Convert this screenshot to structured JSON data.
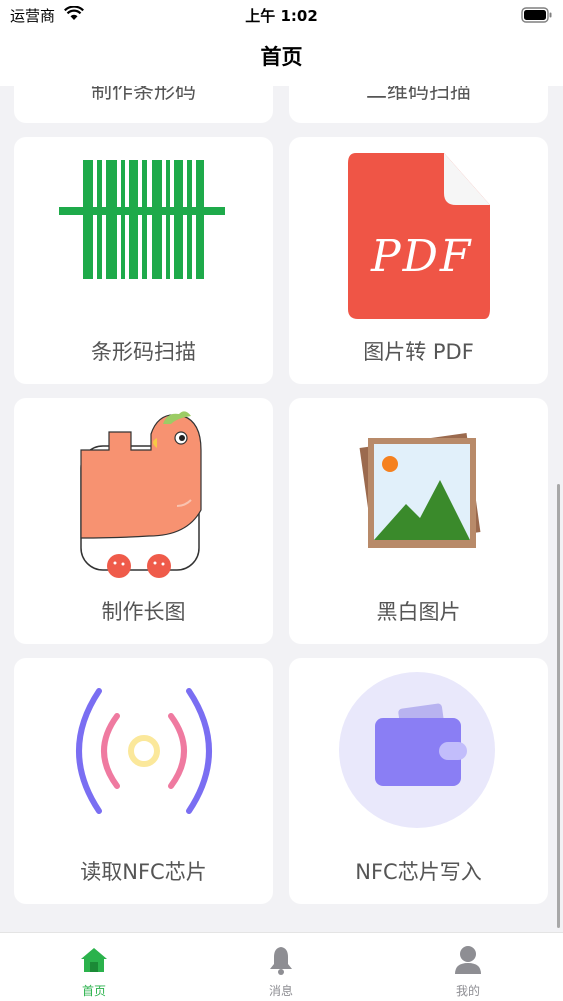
{
  "status_bar": {
    "carrier": "运营商",
    "time": "上午 1:02"
  },
  "nav": {
    "title": "首页"
  },
  "grid": {
    "partial_top": [
      {
        "label": "制作条形码"
      },
      {
        "label": "二维码扫描"
      }
    ],
    "items": [
      {
        "label": "条形码扫描",
        "icon": "barcode-icon"
      },
      {
        "label": "图片转 PDF",
        "icon": "pdf-file-icon",
        "icon_text": "PDF"
      },
      {
        "label": "制作长图",
        "icon": "dinosaur-icon"
      },
      {
        "label": "黑白图片",
        "icon": "photo-icon"
      },
      {
        "label": "读取NFC芯片",
        "icon": "nfc-signal-icon"
      },
      {
        "label": "NFC芯片写入",
        "icon": "wallet-icon"
      }
    ]
  },
  "tab_bar": {
    "active_color": "#2bb24c",
    "inactive_color": "#8e8e93",
    "tabs": [
      {
        "label": "首页",
        "icon": "home-icon",
        "active": true
      },
      {
        "label": "消息",
        "icon": "bell-icon",
        "active": false
      },
      {
        "label": "我的",
        "icon": "person-icon",
        "active": false
      }
    ]
  }
}
